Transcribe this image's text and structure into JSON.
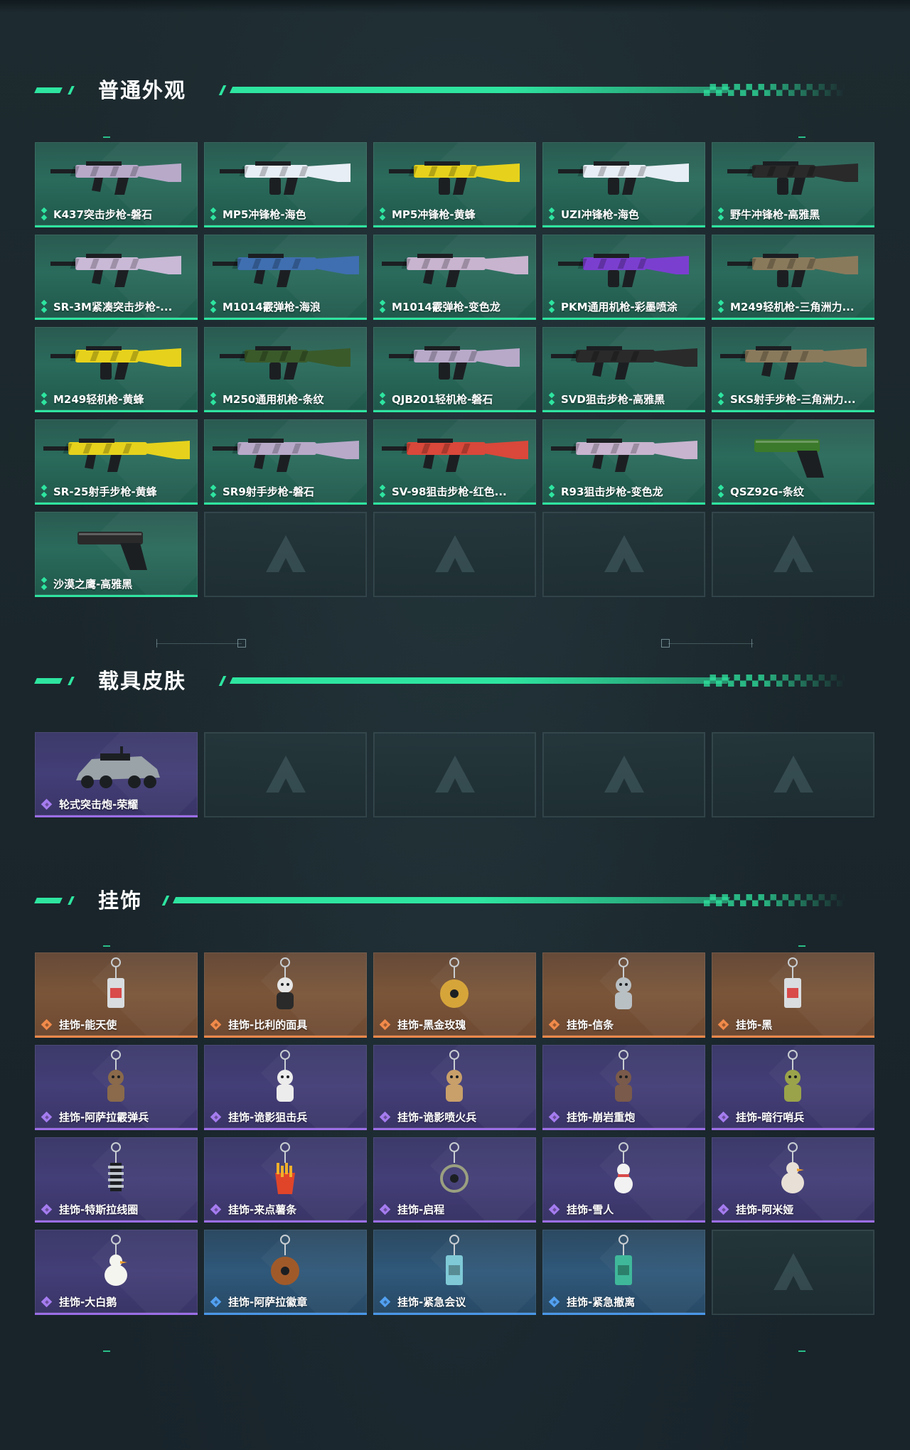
{
  "sections": [
    {
      "title": "普通外观",
      "items": [
        {
          "label": "K437突击步枪-磐石",
          "rarity": "green",
          "icon": "assault-rifle-icon",
          "accent": "#b8a9c9"
        },
        {
          "label": "MP5冲锋枪-海色",
          "rarity": "green",
          "icon": "submachine-gun-icon",
          "accent": "#e8eef5"
        },
        {
          "label": "MP5冲锋枪-黄蜂",
          "rarity": "green",
          "icon": "submachine-gun-icon",
          "accent": "#e6d21c"
        },
        {
          "label": "UZI冲锋枪-海色",
          "rarity": "green",
          "icon": "submachine-gun-icon",
          "accent": "#e8eef5"
        },
        {
          "label": "野牛冲锋枪-高雅黑",
          "rarity": "green",
          "icon": "submachine-gun-icon",
          "accent": "#2a2a2a"
        },
        {
          "label": "SR-3M紧凑突击步枪-...",
          "rarity": "green",
          "icon": "assault-rifle-icon",
          "accent": "#c9b9d6"
        },
        {
          "label": "M1014霰弹枪-海浪",
          "rarity": "green",
          "icon": "shotgun-icon",
          "accent": "#3f6fb0"
        },
        {
          "label": "M1014霰弹枪-变色龙",
          "rarity": "green",
          "icon": "shotgun-icon",
          "accent": "#c8b4cf"
        },
        {
          "label": "PKM通用机枪-彩墨喷涂",
          "rarity": "green",
          "icon": "machine-gun-icon",
          "accent": "#7b3fd0"
        },
        {
          "label": "M249轻机枪-三角洲力...",
          "rarity": "green",
          "icon": "machine-gun-icon",
          "accent": "#8a7a5c"
        },
        {
          "label": "M249轻机枪-黄蜂",
          "rarity": "green",
          "icon": "machine-gun-icon",
          "accent": "#e6d21c"
        },
        {
          "label": "M250通用机枪-条纹",
          "rarity": "green",
          "icon": "machine-gun-icon",
          "accent": "#3a5a2a"
        },
        {
          "label": "QJB201轻机枪-磐石",
          "rarity": "green",
          "icon": "machine-gun-icon",
          "accent": "#b8a9c9"
        },
        {
          "label": "SVD狙击步枪-高雅黑",
          "rarity": "green",
          "icon": "sniper-rifle-icon",
          "accent": "#2a2a2a"
        },
        {
          "label": "SKS射手步枪-三角洲力...",
          "rarity": "green",
          "icon": "marksman-rifle-icon",
          "accent": "#8a7a5c"
        },
        {
          "label": "SR-25射手步枪-黄蜂",
          "rarity": "green",
          "icon": "marksman-rifle-icon",
          "accent": "#e6d21c"
        },
        {
          "label": "SR9射手步枪-磐石",
          "rarity": "green",
          "icon": "marksman-rifle-icon",
          "accent": "#b8a9c9"
        },
        {
          "label": "SV-98狙击步枪-红色...",
          "rarity": "green",
          "icon": "sniper-rifle-icon",
          "accent": "#d9483a"
        },
        {
          "label": "R93狙击步枪-变色龙",
          "rarity": "green",
          "icon": "sniper-rifle-icon",
          "accent": "#c8b4cf"
        },
        {
          "label": "QSZ92G-条纹",
          "rarity": "green",
          "icon": "pistol-icon",
          "accent": "#3a7a2a"
        },
        {
          "label": "沙漠之鹰-高雅黑",
          "rarity": "green",
          "icon": "pistol-icon",
          "accent": "#2a2a2a"
        },
        {
          "empty": true
        },
        {
          "empty": true
        },
        {
          "empty": true
        },
        {
          "empty": true
        }
      ]
    },
    {
      "title": "载具皮肤",
      "items": [
        {
          "label": "轮式突击炮-荣耀",
          "rarity": "purple",
          "icon": "vehicle-icon",
          "accent": "#9aa3a8"
        },
        {
          "empty": true
        },
        {
          "empty": true
        },
        {
          "empty": true
        },
        {
          "empty": true
        }
      ]
    },
    {
      "title": "挂饰",
      "items": [
        {
          "label": "挂饰-能天使",
          "rarity": "orange",
          "icon": "charm-tag-icon",
          "accent": "#d9dde0"
        },
        {
          "label": "挂饰-比利的面具",
          "rarity": "orange",
          "icon": "charm-mask-icon",
          "accent": "#e6e6e6"
        },
        {
          "label": "挂饰-黑金玫瑰",
          "rarity": "orange",
          "icon": "charm-rose-icon",
          "accent": "#d6a53a"
        },
        {
          "label": "挂饰-信条",
          "rarity": "orange",
          "icon": "charm-figure-icon",
          "accent": "#b9c0c4"
        },
        {
          "label": "挂饰-黑",
          "rarity": "orange",
          "icon": "charm-tag-icon",
          "accent": "#d9dde0"
        },
        {
          "label": "挂饰-阿萨拉霰弹兵",
          "rarity": "purple",
          "icon": "charm-figure-icon",
          "accent": "#8a6a4a"
        },
        {
          "label": "挂饰-诡影狙击兵",
          "rarity": "purple",
          "icon": "charm-figure-icon",
          "accent": "#ececec"
        },
        {
          "label": "挂饰-诡影喷火兵",
          "rarity": "purple",
          "icon": "charm-figure-icon",
          "accent": "#c9a06a"
        },
        {
          "label": "挂饰-崩岩重炮",
          "rarity": "purple",
          "icon": "charm-figure-icon",
          "accent": "#7a5a4a"
        },
        {
          "label": "挂饰-暗行哨兵",
          "rarity": "purple",
          "icon": "charm-figure-icon",
          "accent": "#9aa34a"
        },
        {
          "label": "挂饰-特斯拉线圈",
          "rarity": "purple",
          "icon": "charm-coil-icon",
          "accent": "#bfc6cc"
        },
        {
          "label": "挂饰-来点薯条",
          "rarity": "purple",
          "icon": "charm-fries-icon",
          "accent": "#f0b02a"
        },
        {
          "label": "挂饰-启程",
          "rarity": "purple",
          "icon": "charm-ring-icon",
          "accent": "#9aa080"
        },
        {
          "label": "挂饰-雪人",
          "rarity": "purple",
          "icon": "charm-snowman-icon",
          "accent": "#f2f2f2"
        },
        {
          "label": "挂饰-阿米娅",
          "rarity": "purple",
          "icon": "charm-bunny-icon",
          "accent": "#e8e0d6"
        },
        {
          "label": "挂饰-大白鹅",
          "rarity": "purple",
          "icon": "charm-goose-icon",
          "accent": "#f5f5f0"
        },
        {
          "label": "挂饰-阿萨拉徽章",
          "rarity": "blue",
          "icon": "charm-badge-icon",
          "accent": "#a05a2a"
        },
        {
          "label": "挂饰-紧急会议",
          "rarity": "blue",
          "icon": "charm-card-icon",
          "accent": "#7fc9d6"
        },
        {
          "label": "挂饰-紧急撤离",
          "rarity": "blue",
          "icon": "charm-box-icon",
          "accent": "#3fb89a"
        },
        {
          "empty": true
        }
      ]
    }
  ],
  "colors": {
    "green_accent": "#2ee5a0",
    "purple_accent": "#9b6ee6",
    "orange_accent": "#f0884a",
    "blue_accent": "#4a97e8"
  }
}
